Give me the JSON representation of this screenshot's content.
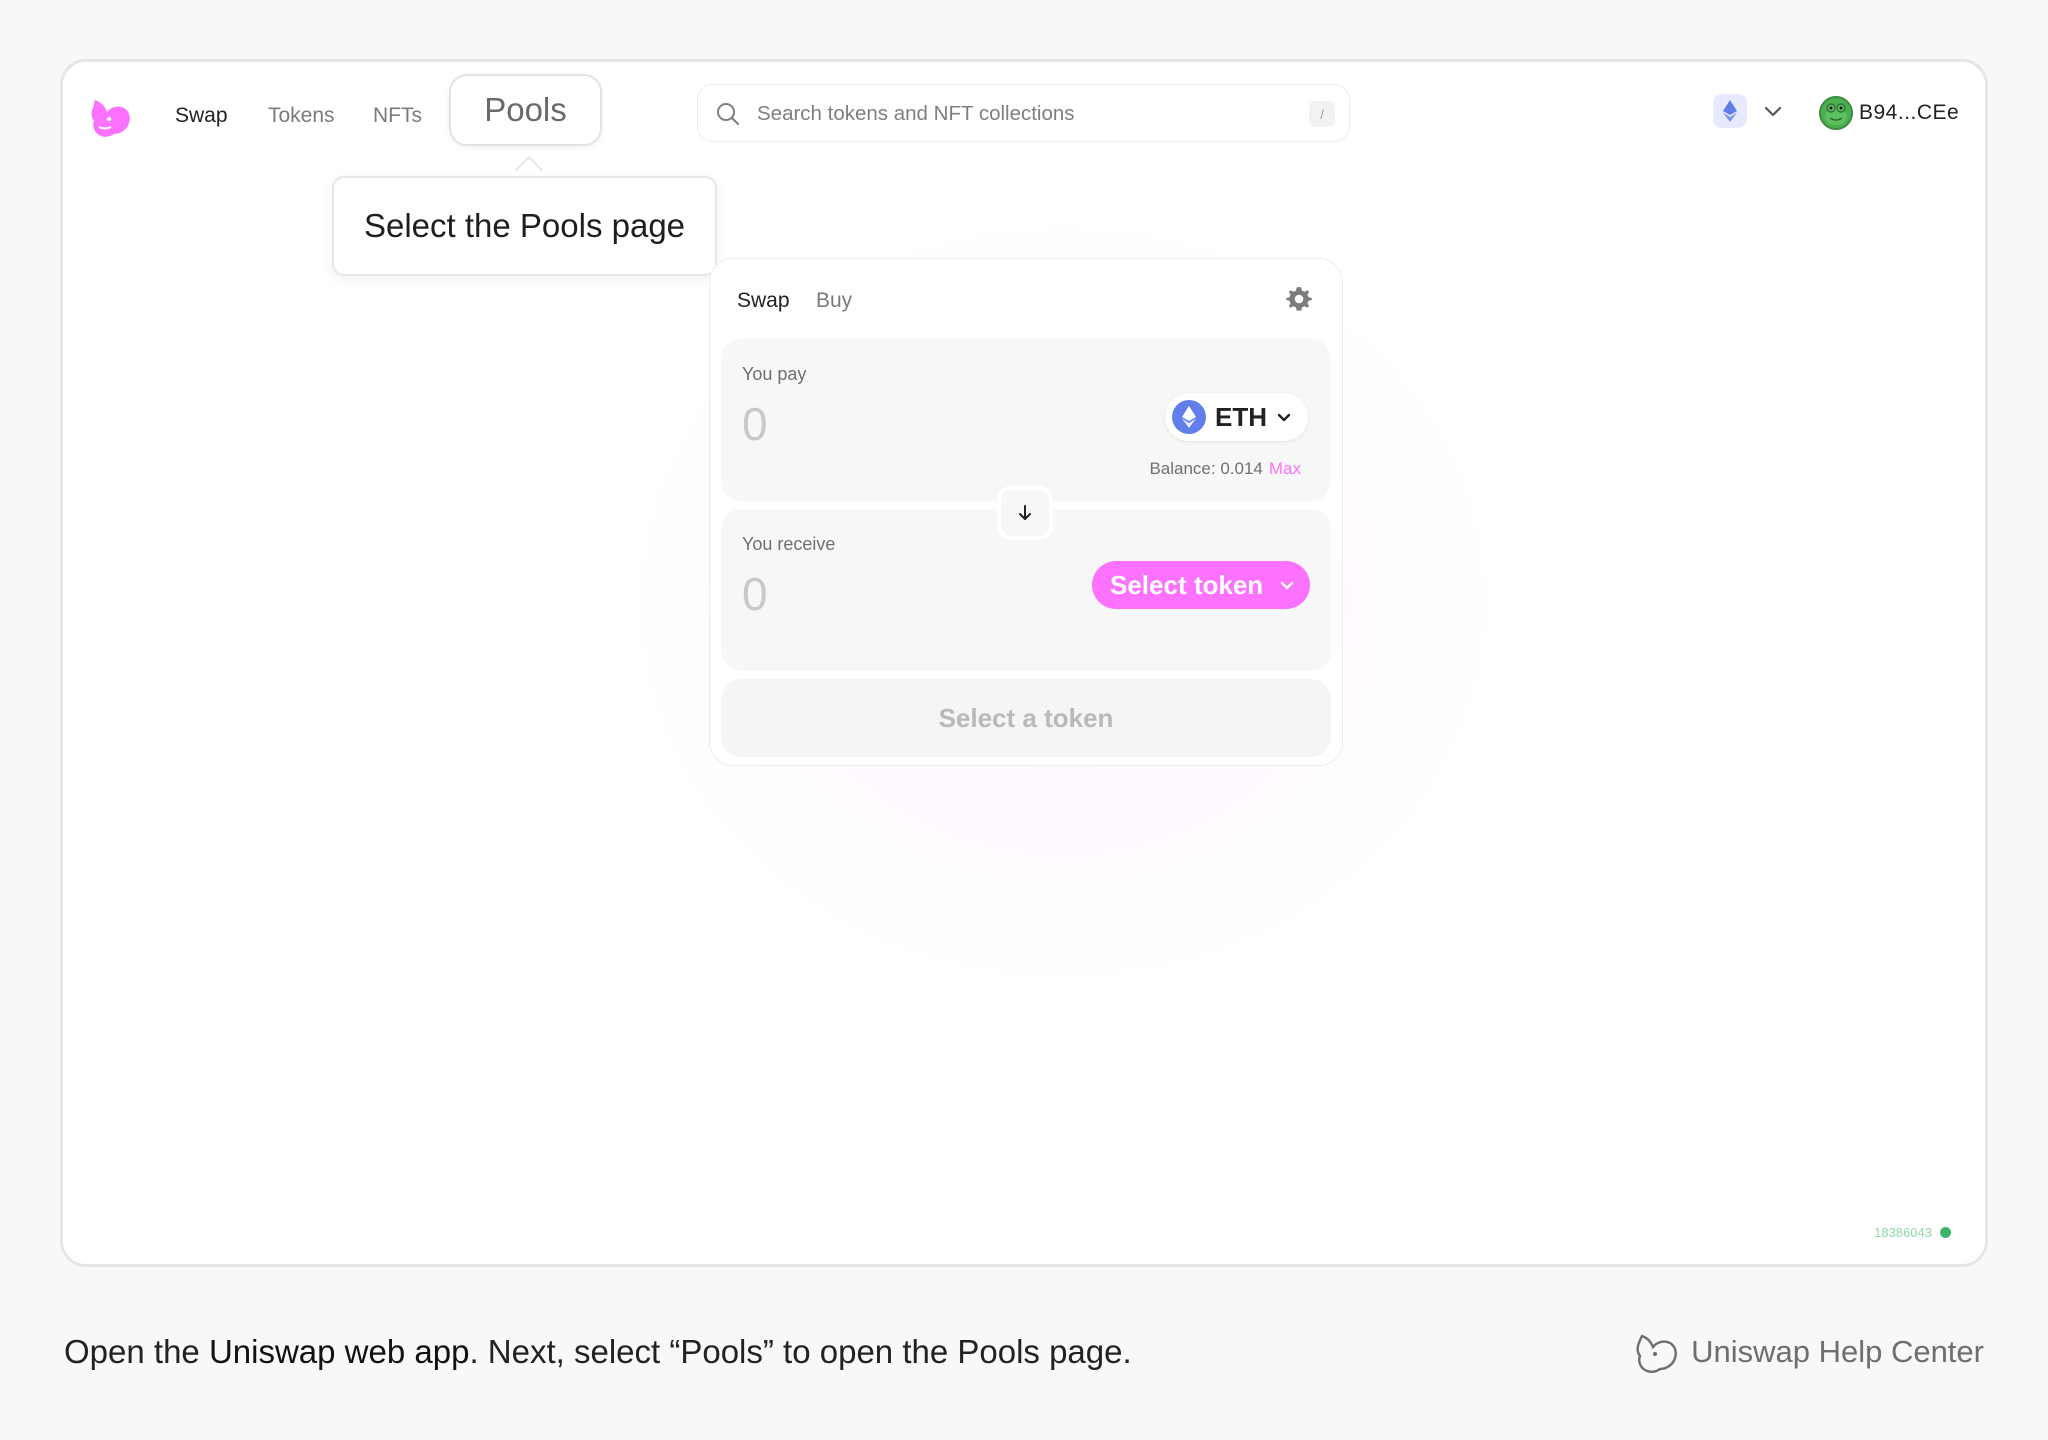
{
  "nav": {
    "links": [
      "Swap",
      "Tokens",
      "NFTs"
    ],
    "pools_label": "Pools"
  },
  "search": {
    "placeholder": "Search tokens and NFT collections",
    "shortcut": "/"
  },
  "wallet": {
    "address": "B94...CEe"
  },
  "tooltip": {
    "text": "Select the Pools page"
  },
  "swap_card": {
    "tabs": [
      "Swap",
      "Buy"
    ],
    "pay": {
      "label": "You pay",
      "amount": "0",
      "token": "ETH",
      "balance": "Balance: 0.014",
      "max_label": "Max"
    },
    "receive": {
      "label": "You receive",
      "amount": "0",
      "select_label": "Select token"
    },
    "cta_label": "Select a token"
  },
  "build": {
    "id": "18386043"
  },
  "footer": {
    "caption_prefix": "Open the ",
    "caption_link": "Uniswap web app",
    "caption_suffix": ". Next, select “Pools” to open the Pools page.",
    "help_label": "Uniswap Help Center"
  },
  "colors": {
    "accent": "#fc72ff",
    "eth": "#627eea",
    "status": "#40b66b"
  }
}
